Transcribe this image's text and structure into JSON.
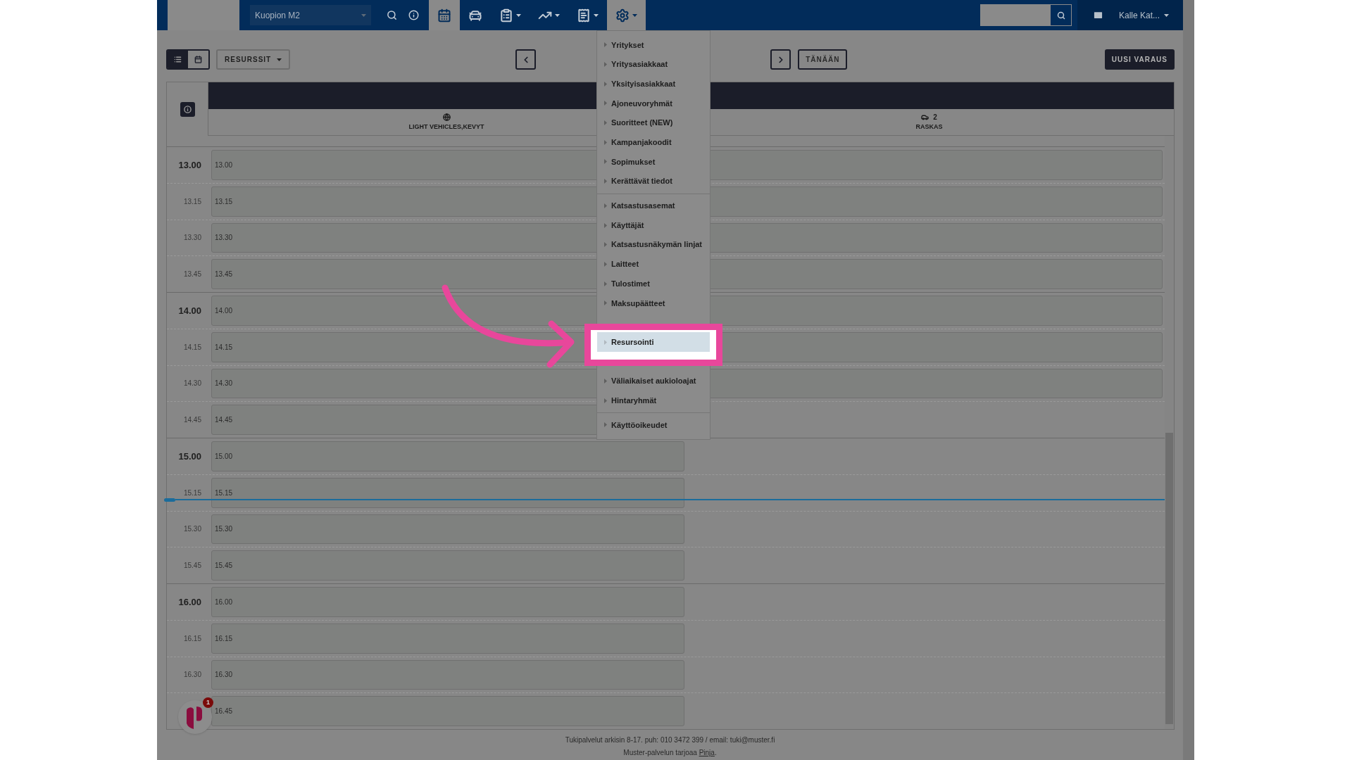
{
  "nav": {
    "location_select": {
      "value": "Kuopion M2"
    },
    "buttons": [
      {
        "kind": "search",
        "selected": false,
        "caret": false
      },
      {
        "kind": "info",
        "selected": false,
        "caret": false
      },
      {
        "kind": "calendar",
        "selected": true,
        "caret": false
      },
      {
        "kind": "car",
        "selected": false,
        "caret": false
      },
      {
        "kind": "clipboard",
        "selected": false,
        "caret": true
      },
      {
        "kind": "chart",
        "selected": false,
        "caret": true
      },
      {
        "kind": "receipt",
        "selected": false,
        "caret": true
      },
      {
        "kind": "settings",
        "selected": true,
        "caret": true
      }
    ],
    "user": {
      "name": "Kalle Kat..."
    }
  },
  "toolbar": {
    "views": [
      {
        "kind": "list",
        "selected": true
      },
      {
        "kind": "calendar",
        "selected": false
      }
    ],
    "resources_button": "RESURSSIT",
    "today_button": "TÄNÄÄN",
    "new_button": "UUSI VARAUS"
  },
  "columns": [
    {
      "kind": "globe",
      "label": "LIGHT VEHICLES,KEVYT"
    },
    {
      "kind": "car",
      "count": "2",
      "label": "RASKAS"
    }
  ],
  "rows": [
    {
      "label": "13.00",
      "major": true,
      "slot": "13.00",
      "heavy_slot": true,
      "now": false
    },
    {
      "label": "13.15",
      "major": false,
      "slot": "13.15",
      "heavy_slot": true,
      "now": false
    },
    {
      "label": "13.30",
      "major": false,
      "slot": "13.30",
      "heavy_slot": true,
      "now": false
    },
    {
      "label": "13.45",
      "major": false,
      "slot": "13.45",
      "heavy_slot": true,
      "now": false
    },
    {
      "label": "14.00",
      "major": true,
      "slot": "14.00",
      "heavy_slot": true,
      "now": false
    },
    {
      "label": "14.15",
      "major": false,
      "slot": "14.15",
      "heavy_slot": true,
      "now": false
    },
    {
      "label": "14.30",
      "major": false,
      "slot": "14.30",
      "heavy_slot": true,
      "now": false
    },
    {
      "label": "14.45",
      "major": false,
      "slot": "14.45",
      "heavy_slot": false,
      "now": false
    },
    {
      "label": "15.00",
      "major": true,
      "slot": "15.00",
      "heavy_slot": false,
      "now": false
    },
    {
      "label": "15.15",
      "major": false,
      "slot": "15.15",
      "heavy_slot": false,
      "now": true
    },
    {
      "label": "15.30",
      "major": false,
      "slot": "15.30",
      "heavy_slot": false,
      "now": false
    },
    {
      "label": "15.45",
      "major": false,
      "slot": "15.45",
      "heavy_slot": false,
      "now": false
    },
    {
      "label": "16.00",
      "major": true,
      "slot": "16.00",
      "heavy_slot": false,
      "now": false
    },
    {
      "label": "16.15",
      "major": false,
      "slot": "16.15",
      "heavy_slot": false,
      "now": false
    },
    {
      "label": "16.30",
      "major": false,
      "slot": "16.30",
      "heavy_slot": false,
      "now": false
    },
    {
      "major": false,
      "slot": "16.45",
      "heavy_slot": false,
      "now": false
    }
  ],
  "settings_menu": {
    "groups": [
      [
        {
          "kind": "link",
          "label": "Yritykset",
          "selected": false
        },
        {
          "kind": "link",
          "label": "Yritysasiakkaat",
          "selected": false
        },
        {
          "kind": "link",
          "label": "Yksityisasiakkaat",
          "selected": false
        },
        {
          "kind": "link",
          "label": "Ajoneuvoryhmät",
          "selected": false
        },
        {
          "kind": "link",
          "label": "Suoritteet (NEW)",
          "selected": false
        },
        {
          "kind": "link",
          "label": "Kampanjakoodit",
          "selected": false
        },
        {
          "kind": "link",
          "label": "Sopimukset",
          "selected": false
        },
        {
          "kind": "link",
          "label": "Kerättävät tiedot",
          "selected": false
        }
      ],
      [
        {
          "kind": "link",
          "label": "Katsastusasemat",
          "selected": false
        },
        {
          "kind": "link",
          "label": "Käyttäjät",
          "selected": false
        },
        {
          "kind": "link",
          "label": "Katsastusnäkymän linjat",
          "selected": false
        },
        {
          "kind": "link",
          "label": "Laitteet",
          "selected": false
        },
        {
          "kind": "link",
          "label": "Tulostimet",
          "selected": false
        },
        {
          "kind": "link",
          "label": "Maksupäätteet",
          "selected": false
        },
        {
          "kind": "covered"
        },
        {
          "kind": "link",
          "label": "Resursointi",
          "selected": true
        },
        {
          "kind": "covered"
        },
        {
          "kind": "link",
          "label": "Väliaikaiset aukioloajat",
          "selected": false
        },
        {
          "kind": "link",
          "label": "Hintaryhmät",
          "selected": false
        }
      ],
      [
        {
          "kind": "link",
          "label": "Käyttöoikeudet",
          "selected": false
        }
      ]
    ]
  },
  "chat_widget": {
    "badge": "1"
  },
  "footer": {
    "support": "Tukipalvelut arkisin 8-17. puh: 010 3472 399 / email: tuki@muster.fi",
    "credit": "Muster-palvelun tarjoaa",
    "credit_link": "Pinja",
    "credit_end": "."
  }
}
